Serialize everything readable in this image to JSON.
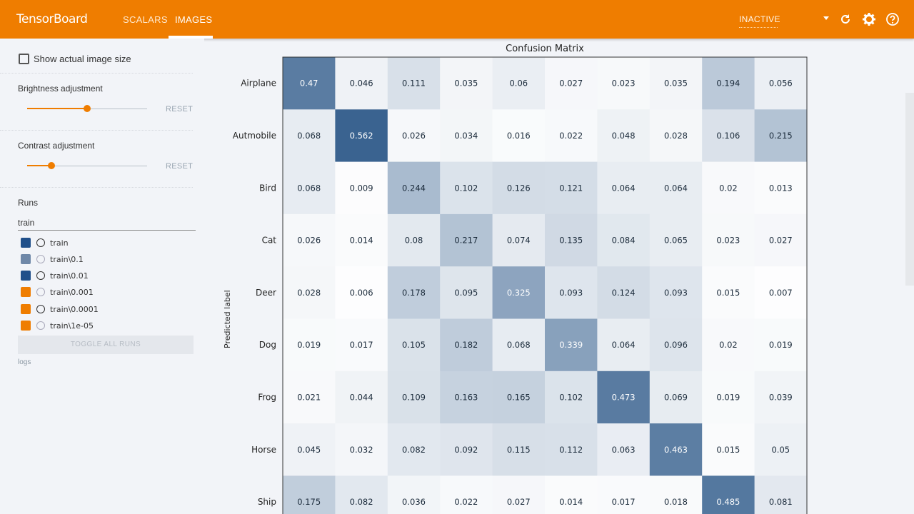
{
  "header": {
    "brand": "TensorBoard",
    "tabs": [
      {
        "label": "SCALARS",
        "active": false
      },
      {
        "label": "IMAGES",
        "active": true
      }
    ],
    "status": "INACTIVE",
    "accent_color": "#ef7d00",
    "icons": [
      "refresh-icon",
      "settings-icon",
      "help-icon"
    ]
  },
  "sidebar": {
    "show_size_label": "Show actual image size",
    "show_size_checked": false,
    "brightness": {
      "label": "Brightness adjustment",
      "reset": "RESET",
      "value": 0.5
    },
    "contrast": {
      "label": "Contrast adjustment",
      "reset": "RESET",
      "value": 0.2
    },
    "runs_title": "Runs",
    "filter_value": "train",
    "runs": [
      {
        "name": "train",
        "color": "#1f4f8a",
        "checked": true
      },
      {
        "name": "train\\0.1",
        "color": "#6f88a8",
        "checked": true
      },
      {
        "name": "train\\0.01",
        "color": "#1f4f8a",
        "checked": true
      },
      {
        "name": "train\\0.001",
        "color": "#ef7d00",
        "checked": true
      },
      {
        "name": "train\\0.0001",
        "color": "#ef7d00",
        "checked": true
      },
      {
        "name": "train\\1e-05",
        "color": "#ef7d00",
        "checked": true
      }
    ],
    "toggle_label": "TOGGLE ALL RUNS",
    "logdir": "logs"
  },
  "chart_data": {
    "type": "heatmap",
    "title": "Confusion Matrix",
    "ylabel": "Predicted label",
    "rows": [
      "Airplane",
      "Autmobile",
      "Bird",
      "Cat",
      "Deer",
      "Dog",
      "Frog",
      "Horse",
      "Ship"
    ],
    "values": [
      [
        0.47,
        0.046,
        0.111,
        0.035,
        0.06,
        0.027,
        0.023,
        0.035,
        0.194,
        0.056
      ],
      [
        0.068,
        0.562,
        0.026,
        0.034,
        0.016,
        0.022,
        0.048,
        0.028,
        0.106,
        0.215
      ],
      [
        0.068,
        0.009,
        0.244,
        0.102,
        0.126,
        0.121,
        0.064,
        0.064,
        0.02,
        0.013
      ],
      [
        0.026,
        0.014,
        0.08,
        0.217,
        0.074,
        0.135,
        0.084,
        0.065,
        0.023,
        0.027
      ],
      [
        0.028,
        0.006,
        0.178,
        0.095,
        0.325,
        0.093,
        0.124,
        0.093,
        0.015,
        0.007
      ],
      [
        0.019,
        0.017,
        0.105,
        0.182,
        0.068,
        0.339,
        0.064,
        0.096,
        0.02,
        0.019
      ],
      [
        0.021,
        0.044,
        0.109,
        0.163,
        0.165,
        0.102,
        0.473,
        0.069,
        0.019,
        0.039
      ],
      [
        0.045,
        0.032,
        0.082,
        0.092,
        0.115,
        0.112,
        0.063,
        0.463,
        0.015,
        0.05
      ],
      [
        0.175,
        0.082,
        0.036,
        0.022,
        0.027,
        0.014,
        0.017,
        0.018,
        0.485,
        0.081
      ]
    ],
    "colormap": [
      "#ffffff",
      "#3a6390"
    ],
    "vmax": 0.56
  }
}
